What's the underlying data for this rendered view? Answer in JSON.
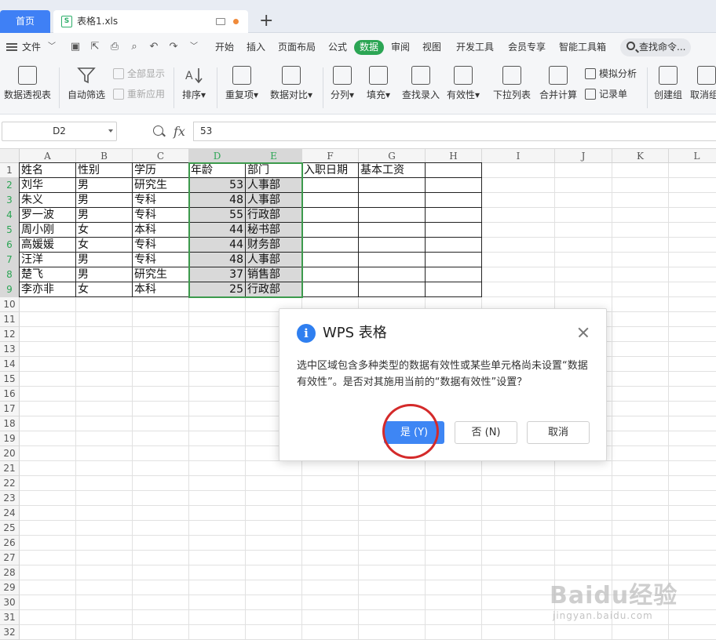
{
  "tabs": {
    "home_label": "首页",
    "file_label": "表格1.xls",
    "new_tab_label": "+"
  },
  "menu": {
    "file_label": "文件",
    "items": [
      "开始",
      "插入",
      "页面布局",
      "公式",
      "数据",
      "审阅",
      "视图",
      "开发工具",
      "会员专享",
      "智能工具箱"
    ],
    "active": "数据",
    "search_label": "查找命令..."
  },
  "ribbon": {
    "pivot": "数据透视表",
    "autofilter": "自动筛选",
    "show_all": "全部显示",
    "reapply": "重新应用",
    "sort": "排序",
    "duplicates": "重复项",
    "compare": "数据对比",
    "split": "分列",
    "fill": "填充",
    "lookup": "查找录入",
    "validity": "有效性",
    "dropdown": "下拉列表",
    "consolidate": "合并计算",
    "simulate": "模拟分析",
    "record": "记录单",
    "group": "创建组",
    "ungroup": "取消组"
  },
  "formula_bar": {
    "cell_ref": "D2",
    "fx": "fx",
    "value": "53"
  },
  "sheet": {
    "columns": [
      "A",
      "B",
      "C",
      "D",
      "E",
      "F",
      "G",
      "H",
      "I",
      "J",
      "K",
      "L"
    ],
    "selected_columns": [
      "D",
      "E"
    ],
    "selected_rows": [
      2,
      3,
      4,
      5,
      6,
      7,
      8,
      9
    ],
    "row_count": 32,
    "headers": [
      "姓名",
      "性别",
      "学历",
      "年龄",
      "部门",
      "入职日期",
      "基本工资"
    ],
    "rows": [
      [
        "刘华",
        "男",
        "研究生",
        "53",
        "人事部"
      ],
      [
        "朱义",
        "男",
        "专科",
        "48",
        "人事部"
      ],
      [
        "罗一波",
        "男",
        "专科",
        "55",
        "行政部"
      ],
      [
        "周小刚",
        "女",
        "本科",
        "44",
        "秘书部"
      ],
      [
        "高媛媛",
        "女",
        "专科",
        "44",
        "财务部"
      ],
      [
        "汪洋",
        "男",
        "专科",
        "48",
        "人事部"
      ],
      [
        "楚飞",
        "男",
        "研究生",
        "37",
        "销售部"
      ],
      [
        "李亦非",
        "女",
        "本科",
        "25",
        "行政部"
      ]
    ]
  },
  "dialog": {
    "title": "WPS 表格",
    "message": "选中区域包含多种类型的数据有效性或某些单元格尚未设置“数据有效性”。是否对其施用当前的“数据有效性”设置？",
    "yes": "是 (Y)",
    "no": "否 (N)",
    "cancel": "取消"
  },
  "watermark": {
    "main": "Baidu经验",
    "sub": "jingyan.baidu.com"
  },
  "colors": {
    "accent_blue": "#3f80f5",
    "data_tab_green": "#2ba554",
    "selection_green": "#3c9a4c",
    "annotation_red": "#d42a2a"
  }
}
